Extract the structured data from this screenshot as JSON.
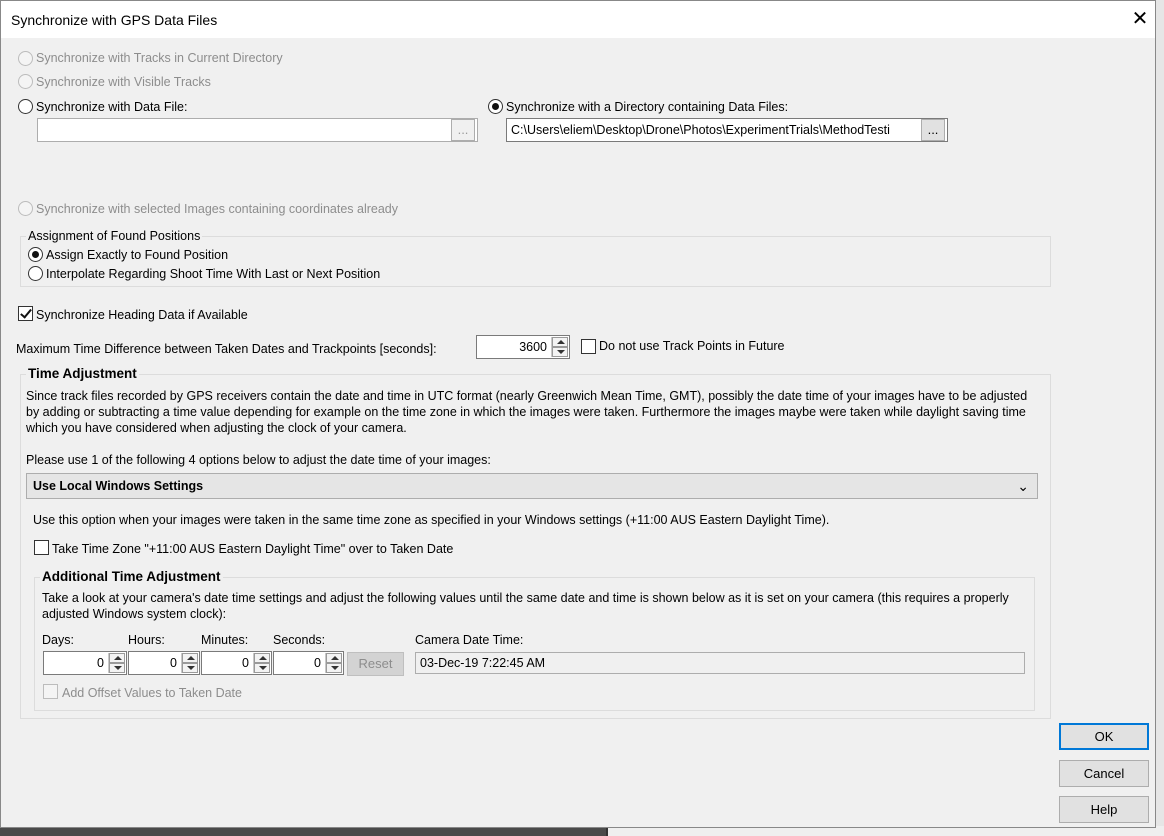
{
  "window": {
    "title": "Synchronize with GPS Data Files",
    "close_glyph": "✕"
  },
  "sync_options": {
    "tracks_current_dir": "Synchronize with Tracks in Current Directory",
    "visible_tracks": "Synchronize with Visible Tracks",
    "data_file": "Synchronize with Data File:",
    "data_file_value": "",
    "directory": "Synchronize with a Directory containing Data Files:",
    "directory_value": "C:\\Users\\eliem\\Desktop\\Drone\\Photos\\ExperimentTrials\\MethodTesti",
    "browse_label": "...",
    "selected_images": "Synchronize with selected Images containing coordinates already"
  },
  "assignment": {
    "legend": "Assignment of Found Positions",
    "exact": "Assign Exactly to Found Position",
    "interpolate": "Interpolate Regarding Shoot Time With Last or Next Position"
  },
  "heading": {
    "label": "Synchronize Heading Data if Available"
  },
  "max_time": {
    "label": "Maximum Time Difference between Taken Dates and Trackpoints [seconds]:",
    "value": "3600",
    "future_label": "Do not use Track Points in Future"
  },
  "time_adjustment": {
    "legend": "Time Adjustment",
    "description": "Since track files recorded by GPS receivers contain the date and time in UTC format (nearly Greenwich Mean Time, GMT), possibly the date time of your images have to be adjusted by adding or subtracting a time value depending for example on the time zone in which the images were taken. Furthermore the images maybe were taken while daylight saving time which you have considered when adjusting the clock of your camera.",
    "options_prompt": "Please use 1 of the following 4 options below to adjust the date time of your images:",
    "selected_option": "Use Local Windows Settings",
    "option_hint": "Use this option when your images were taken in the same time zone as specified in your Windows settings (+11:00 AUS Eastern Daylight Time).",
    "take_zone_label": "Take Time Zone \"+11:00 AUS Eastern Daylight Time\" over to Taken Date"
  },
  "additional": {
    "legend": "Additional Time Adjustment",
    "description": "Take a look at your camera's date time settings and adjust the following values until the same date and time is shown below as it is  set on your camera (this requires a properly adjusted Windows system clock):",
    "days_label": "Days:",
    "hours_label": "Hours:",
    "minutes_label": "Minutes:",
    "seconds_label": "Seconds:",
    "days": "0",
    "hours": "0",
    "minutes": "0",
    "seconds": "0",
    "reset_label": "Reset",
    "camera_label": "Camera Date Time:",
    "camera_value": "03-Dec-19 7:22:45 AM",
    "offset_label": "Add Offset Values to Taken Date"
  },
  "buttons": {
    "ok": "OK",
    "cancel": "Cancel",
    "help": "Help"
  }
}
